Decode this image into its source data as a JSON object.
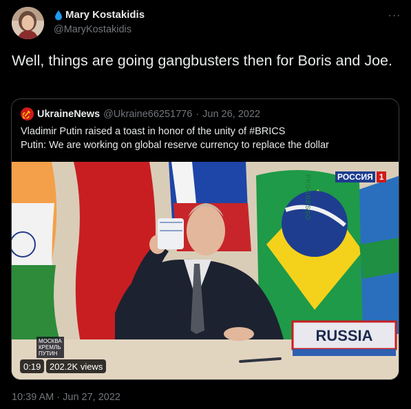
{
  "author": {
    "display_name": "Mary Kostakidis",
    "handle": "@MaryKostakidis",
    "icon": "water-drop-icon",
    "avatar_icon": "profile-photo"
  },
  "menu": {
    "icon": "more-options-icon",
    "glyph": "···"
  },
  "tweet": {
    "text": "Well, things are going gangbusters then for Boris and Joe.",
    "timestamp": "10:39 AM · Jun 27, 2022"
  },
  "quoted": {
    "display_name": "UkraineNews",
    "handle": "@Ukraine66251776",
    "separator": "·",
    "date": "Jun 26, 2022",
    "line1": "Vladimir Putin raised a toast in honor of the unity of  #BRICS",
    "line2": "Putin: We are working on global reserve currency to replace the dollar",
    "avatar_icon": "hammer-sickle-icon"
  },
  "video": {
    "duration": "0:19",
    "views": "202.2K views",
    "channel_label": "РОССИЯ",
    "channel_number": "1",
    "nameplate": "RUSSIA",
    "corner_caption": [
      "МОСКВА",
      "КРЕМЛЬ",
      "ПУТИН"
    ],
    "banner_text": "PROGRESSO"
  },
  "colors": {
    "background": "#000000",
    "text": "#e7e9ea",
    "muted": "#71767b",
    "border": "#3a3d41",
    "drop": "#1d9bf0"
  }
}
